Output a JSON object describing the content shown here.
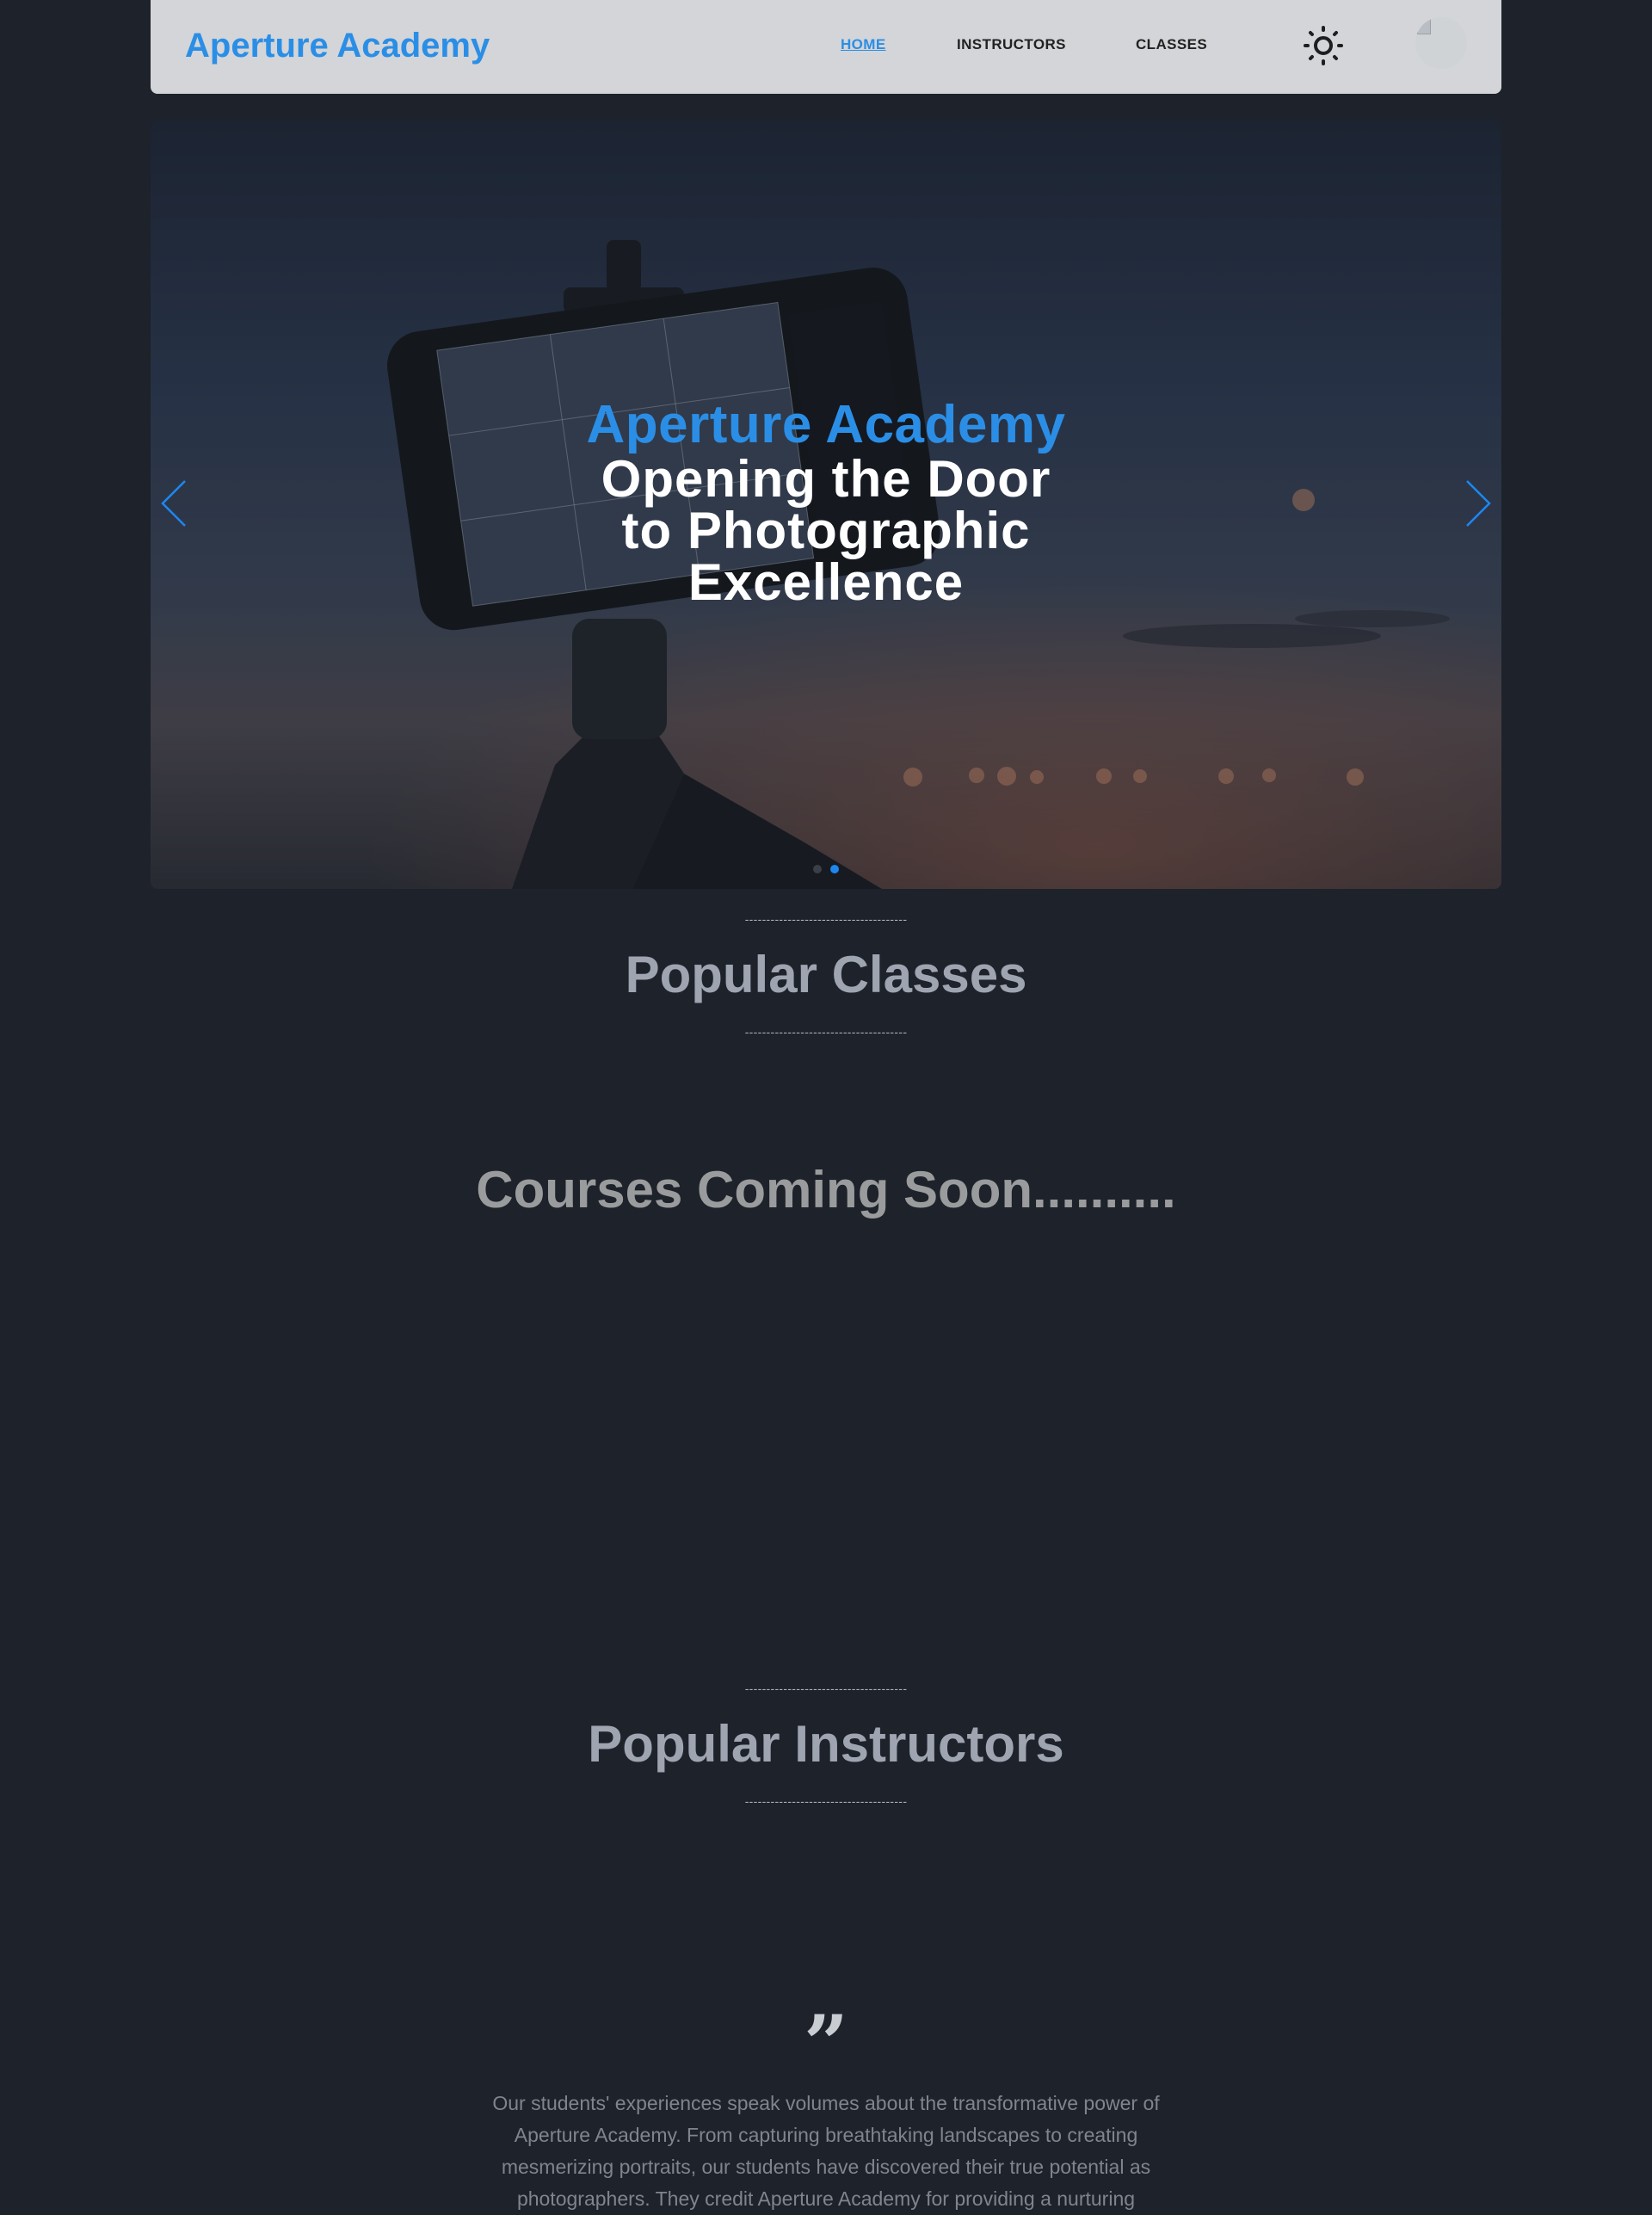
{
  "navbar": {
    "brand": "Aperture Academy",
    "links": [
      {
        "label": "HOME",
        "active": true
      },
      {
        "label": "INSTRUCTORS",
        "active": false
      },
      {
        "label": "CLASSES",
        "active": false
      }
    ],
    "theme_icon": "sun-icon",
    "avatar_icon": "broken-image-avatar"
  },
  "hero": {
    "title": "Aperture Academy",
    "subtitle": "Opening the Door to Photographic Excellence",
    "prev_icon": "chevron-left-icon",
    "next_icon": "chevron-right-icon",
    "slide_count": 2,
    "active_slide": 2,
    "accent_color": "#2b8ee6"
  },
  "sections": {
    "divider": "--------------------------------------",
    "popular_classes": "Popular Classes",
    "courses_coming": "Courses Coming Soon..........",
    "popular_instructors": "Popular Instructors"
  },
  "testimonial": {
    "quote_icon": "quote-icon",
    "quote_glyph": "”",
    "text": "Our students' experiences speak volumes about the transformative power of Aperture Academy. From capturing breathtaking landscapes to creating mesmerizing portraits, our students have discovered their true potential as photographers. They credit Aperture Academy for providing a nurturing"
  },
  "colors": {
    "background": "#1d222b",
    "navbar": "#d3d5d8",
    "brand": "#2b8ee6",
    "section_title": "#9ea4b0"
  }
}
